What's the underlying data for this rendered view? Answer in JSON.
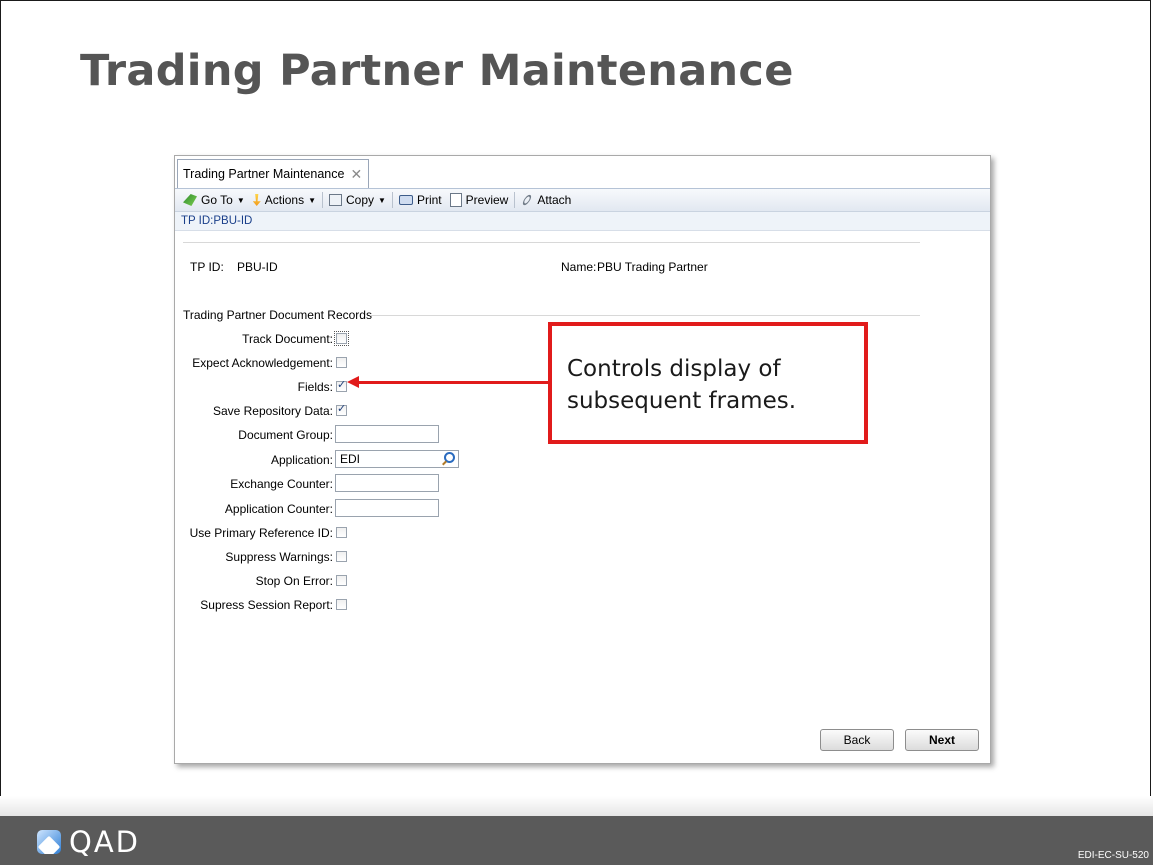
{
  "slide": {
    "title": "Trading Partner Maintenance",
    "course_code": "EDI-EC-SU-520"
  },
  "window": {
    "tab_label": "Trading Partner Maintenance",
    "toolbar": {
      "goto": "Go To",
      "actions": "Actions",
      "copy": "Copy",
      "print": "Print",
      "preview": "Preview",
      "attach": "Attach"
    },
    "tpid_bar": "TP ID:PBU-ID",
    "header": {
      "tpid_label": "TP ID:",
      "tpid_value": "PBU-ID",
      "name_label": "Name:",
      "name_value": "PBU Trading Partner"
    },
    "group_label": "Trading Partner Document Records",
    "fields": {
      "track_document": {
        "label": "Track Document:",
        "checked": false
      },
      "expect_ack": {
        "label": "Expect Acknowledgement:",
        "checked": false
      },
      "fields": {
        "label": "Fields:",
        "checked": true
      },
      "save_repo": {
        "label": "Save Repository Data:",
        "checked": true
      },
      "document_group": {
        "label": "Document Group:",
        "value": ""
      },
      "application": {
        "label": "Application:",
        "value": "EDI"
      },
      "exchange_counter": {
        "label": "Exchange Counter:",
        "value": ""
      },
      "application_counter": {
        "label": "Application Counter:",
        "value": ""
      },
      "use_primary_ref": {
        "label": "Use Primary Reference ID:",
        "checked": false
      },
      "suppress_warnings": {
        "label": "Suppress Warnings:",
        "checked": false
      },
      "stop_on_error": {
        "label": "Stop On Error:",
        "checked": false
      },
      "supress_session": {
        "label": "Supress Session Report:",
        "checked": false
      }
    },
    "buttons": {
      "back": "Back",
      "next": "Next"
    }
  },
  "callout": {
    "line1": "Controls display of",
    "line2": "subsequent frames."
  },
  "footer": {
    "logo_text": "QAD"
  }
}
